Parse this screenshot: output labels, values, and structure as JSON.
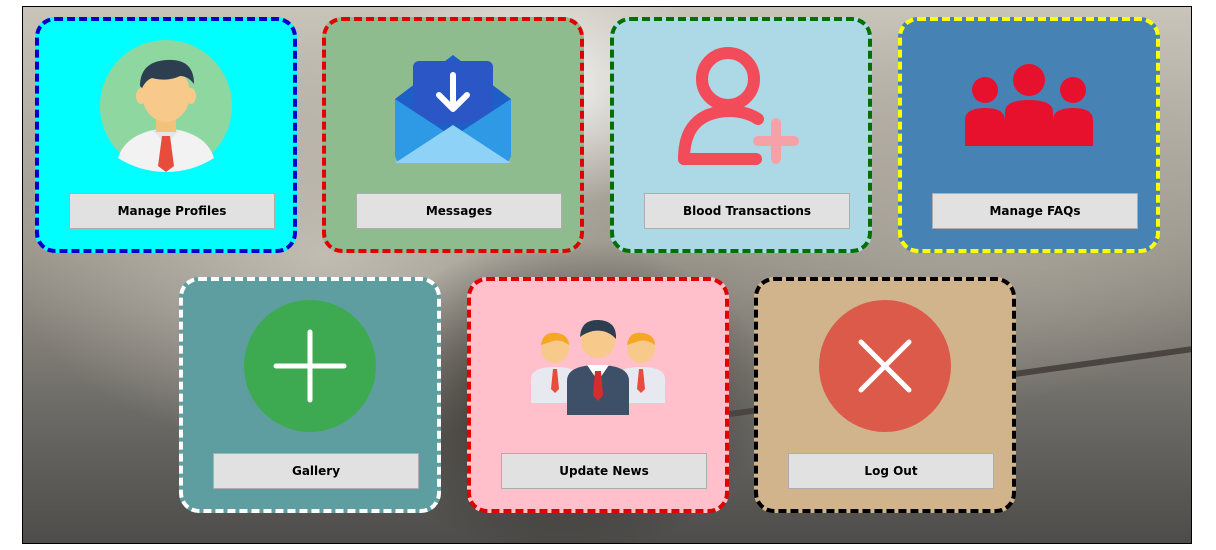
{
  "tiles": [
    {
      "label": "Manage Profiles",
      "icon": "user-profile-icon",
      "bg": "#00ffff",
      "border": "#0000cc"
    },
    {
      "label": "Messages",
      "icon": "envelope-download-icon",
      "bg": "#8fbc8f",
      "border": "#e00000"
    },
    {
      "label": "Blood Transactions",
      "icon": "add-user-icon",
      "bg": "#add8e6",
      "border": "#007000"
    },
    {
      "label": "Manage FAQs",
      "icon": "group-icon",
      "bg": "#4682b4",
      "border": "#ffff00"
    },
    {
      "label": "Gallery",
      "icon": "plus-circle-icon",
      "bg": "#5f9ea0",
      "border": "#ffffff"
    },
    {
      "label": "Update News",
      "icon": "team-icon",
      "bg": "#ffc0cb",
      "border": "#e00000"
    },
    {
      "label": "Log Out",
      "icon": "close-circle-icon",
      "bg": "#d2b48c",
      "border": "#000000"
    }
  ]
}
